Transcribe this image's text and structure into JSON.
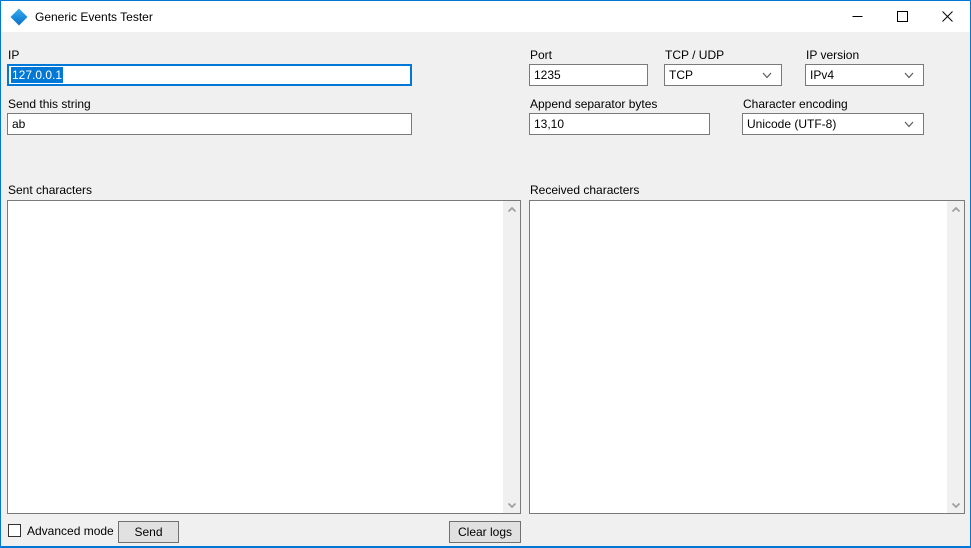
{
  "window": {
    "title": "Generic Events Tester"
  },
  "connection": {
    "ip": {
      "label": "IP",
      "value": "127.0.0.1",
      "selected": true
    },
    "port": {
      "label": "Port",
      "value": "1235"
    },
    "protocol": {
      "label": "TCP / UDP",
      "value": "TCP"
    },
    "ip_version": {
      "label": "IP version",
      "value": "IPv4"
    }
  },
  "message": {
    "send_string": {
      "label": "Send this string",
      "value": "ab"
    },
    "separator_bytes": {
      "label": "Append separator bytes",
      "value": "13,10"
    },
    "encoding": {
      "label": "Character encoding",
      "value": "Unicode (UTF-8)"
    }
  },
  "logs": {
    "sent": {
      "label": "Sent characters",
      "content": ""
    },
    "received": {
      "label": "Received characters",
      "content": ""
    }
  },
  "footer": {
    "advanced_mode": {
      "label": "Advanced mode",
      "checked": false
    },
    "send_button": "Send",
    "clear_button": "Clear logs"
  },
  "icons": {
    "app_icon": "blue-diamond",
    "minimize": "minimize-dash",
    "maximize": "maximize-square",
    "close": "close-x",
    "combo_arrow": "chevron-down",
    "scroll_up": "chevron-up",
    "scroll_down": "chevron-down"
  },
  "colors": {
    "accent": "#0078d7",
    "titlebar_bg": "#ffffff",
    "client_bg": "#f0f0f0",
    "field_border": "#7a7a7a",
    "focused_field_border": "#0078d7",
    "selection_bg": "#0078d7",
    "selection_text": "#ffffff",
    "button_bg": "#e1e1e1",
    "button_border": "#707070",
    "scrollbar_track": "#f0f0f0",
    "scrollbar_arrow": "#a0a0a0"
  }
}
